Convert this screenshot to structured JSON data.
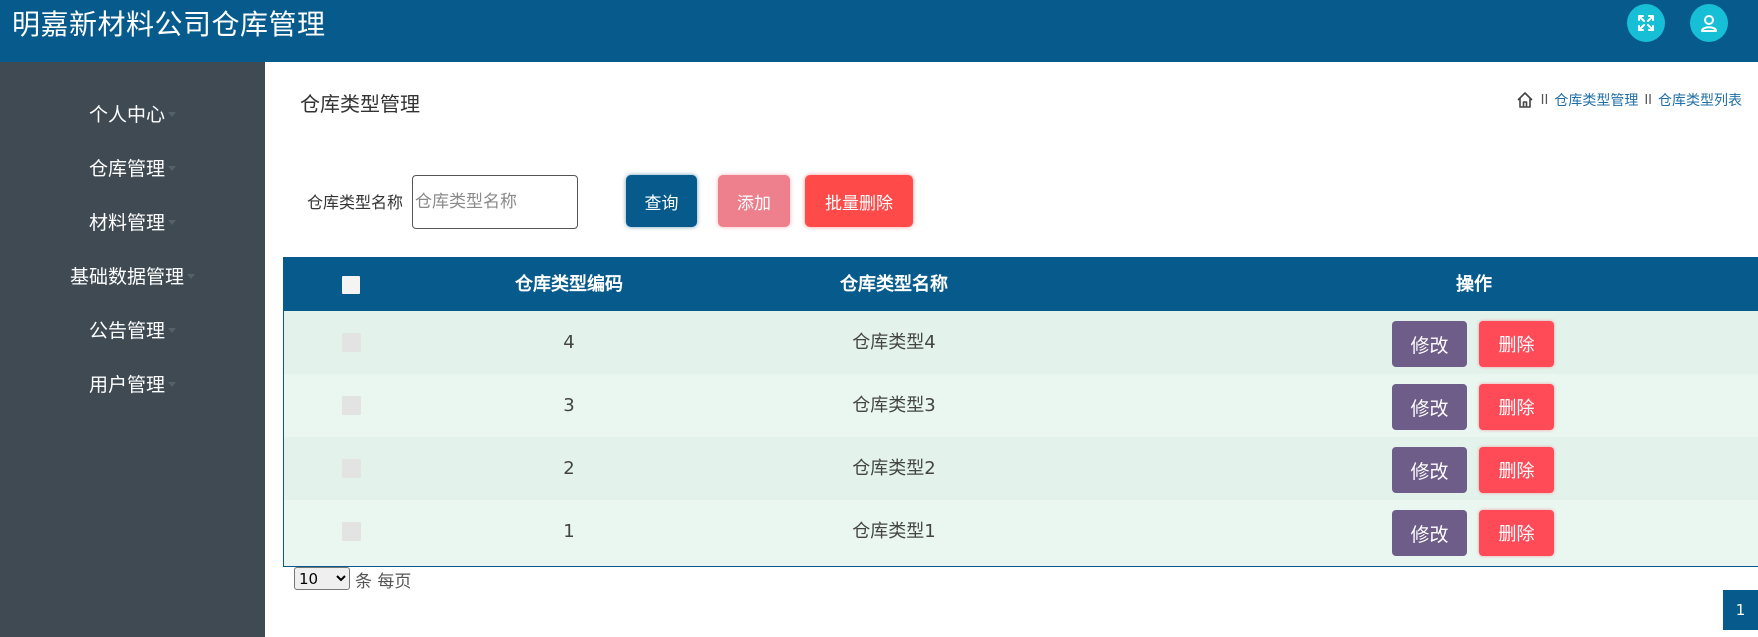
{
  "app": {
    "title": "明嘉新材料公司仓库管理"
  },
  "header": {
    "icons": [
      "fullscreen-icon",
      "user-icon"
    ]
  },
  "sidebar": {
    "items": [
      {
        "label": "个人中心"
      },
      {
        "label": "仓库管理"
      },
      {
        "label": "材料管理"
      },
      {
        "label": "基础数据管理"
      },
      {
        "label": "公告管理"
      },
      {
        "label": "用户管理"
      }
    ]
  },
  "main": {
    "title": "仓库类型管理",
    "breadcrumb": {
      "sep": "II",
      "item1": "仓库类型管理",
      "item2": "仓库类型列表"
    },
    "search": {
      "label": "仓库类型名称",
      "placeholder": "仓库类型名称",
      "value": ""
    },
    "buttons": {
      "query": "查询",
      "add": "添加",
      "bulk_delete": "批量删除"
    },
    "table": {
      "headers": {
        "code": "仓库类型编码",
        "name": "仓库类型名称",
        "actions": "操作"
      },
      "rows": [
        {
          "code": "4",
          "name": "仓库类型4",
          "edit": "修改",
          "delete": "删除"
        },
        {
          "code": "3",
          "name": "仓库类型3",
          "edit": "修改",
          "delete": "删除"
        },
        {
          "code": "2",
          "name": "仓库类型2",
          "edit": "修改",
          "delete": "删除"
        },
        {
          "code": "1",
          "name": "仓库类型1",
          "edit": "修改",
          "delete": "删除"
        }
      ]
    },
    "pagination": {
      "page_size": "10",
      "page_size_options": [
        "10"
      ],
      "page_size_label": "条 每页",
      "current_page": "1"
    }
  },
  "colors": {
    "primary": "#065a8c",
    "sidebar": "#3f4a52",
    "accent_cyan": "#17bfd6",
    "danger": "#ff4a4a",
    "edit": "#6e5c89",
    "add": "#ee7f8d"
  }
}
